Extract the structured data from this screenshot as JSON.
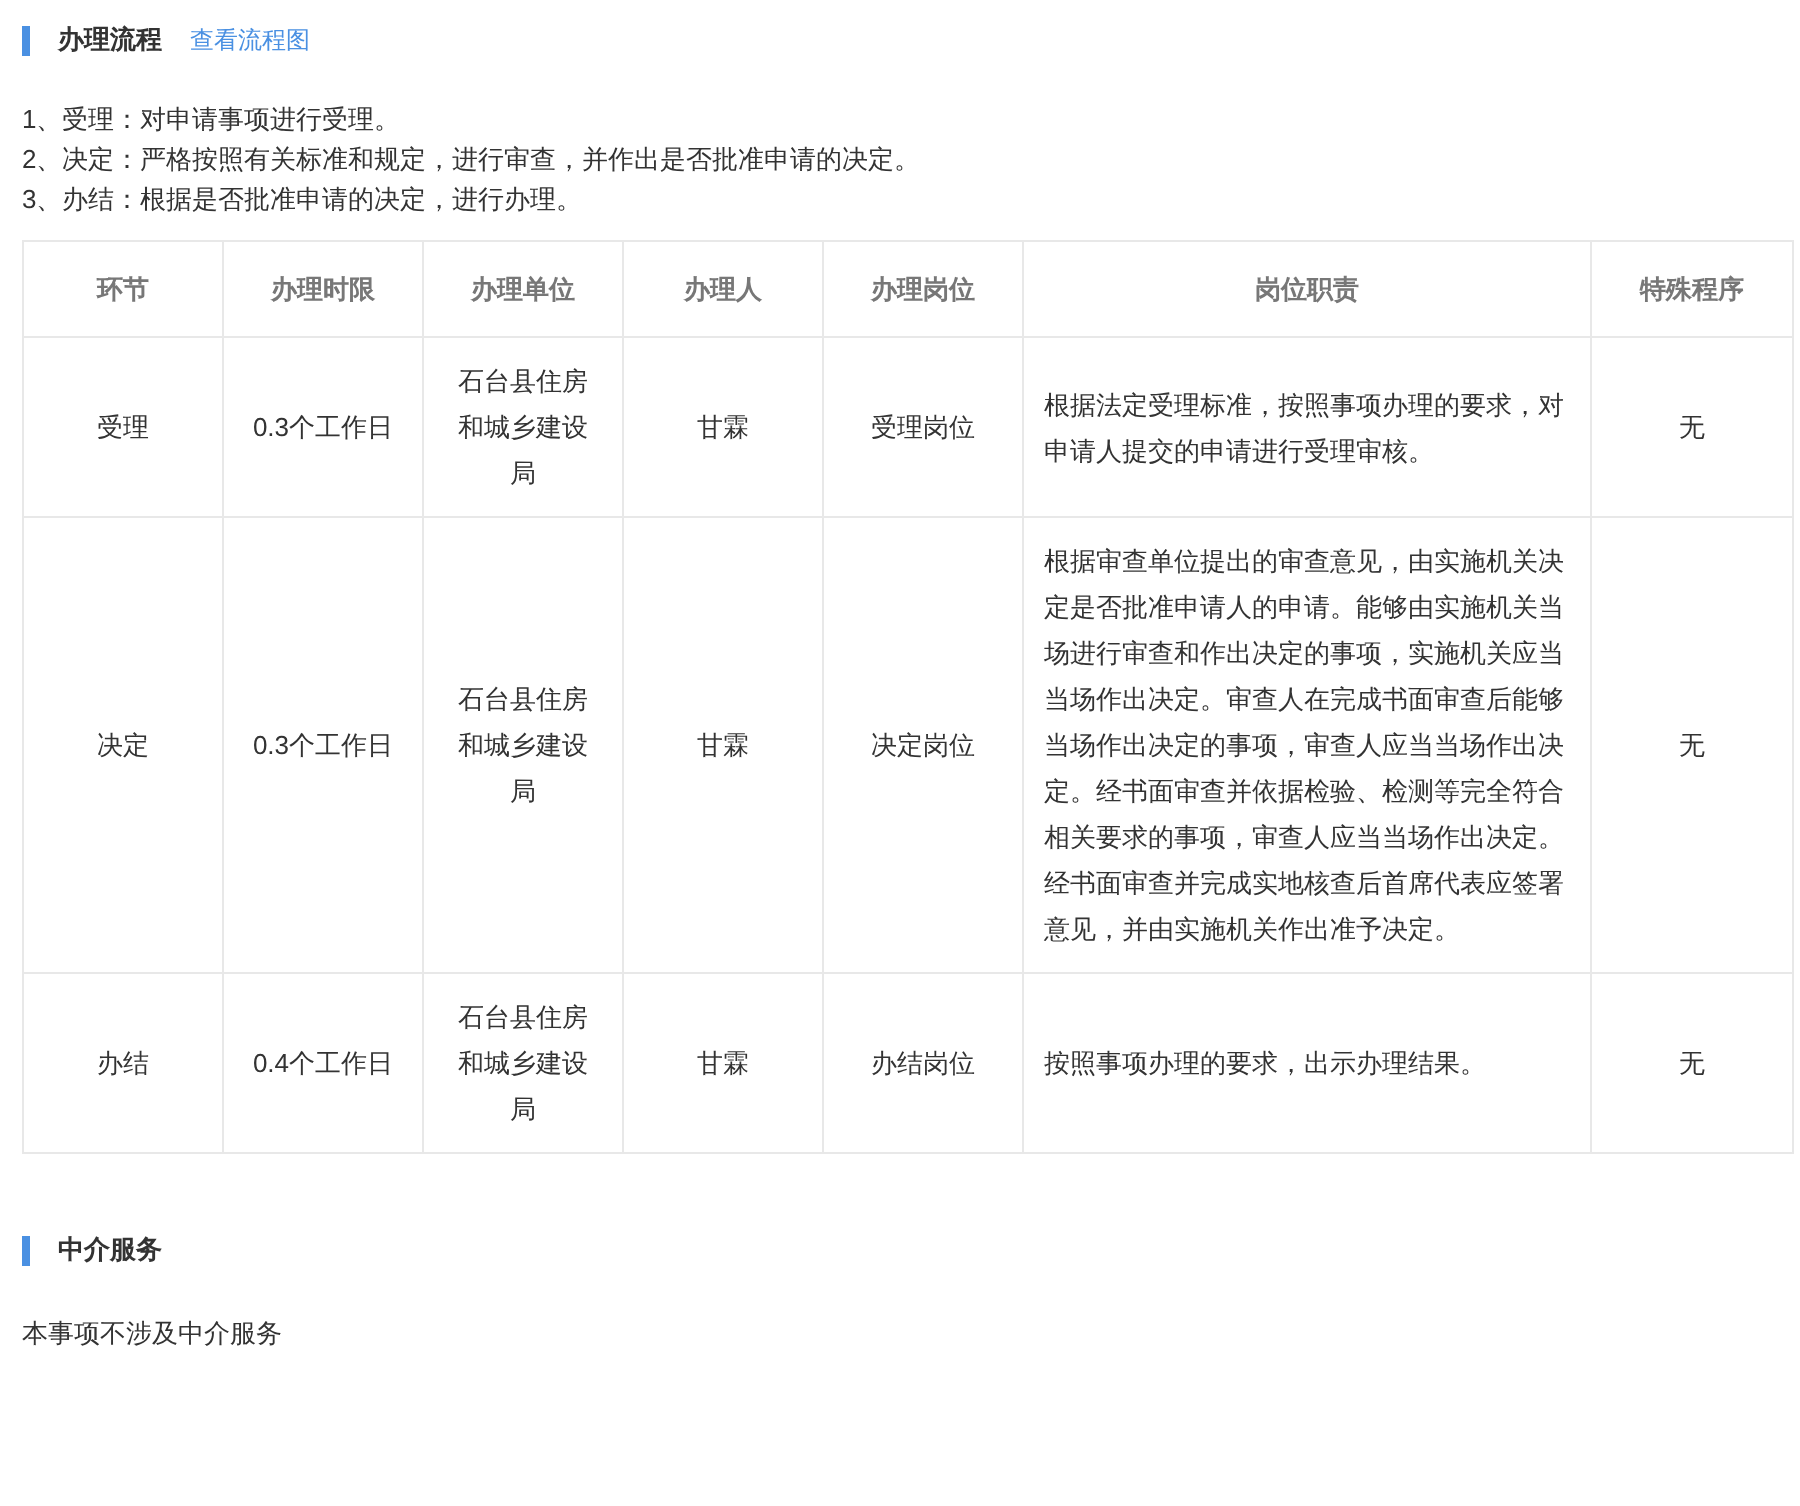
{
  "process": {
    "title": "办理流程",
    "link": "查看流程图",
    "steps": [
      "1、受理：对申请事项进行受理。",
      "2、决定：严格按照有关标准和规定，进行审查，并作出是否批准申请的决定。",
      "3、办结：根据是否批准申请的决定，进行办理。"
    ],
    "table": {
      "columns": [
        "环节",
        "办理时限",
        "办理单位",
        "办理人",
        "办理岗位",
        "岗位职责",
        "特殊程序"
      ],
      "rows": [
        [
          "受理",
          "0.3个工作日",
          "石台县住房和城乡建设局",
          "甘霖",
          "受理岗位",
          "根据法定受理标准，按照事项办理的要求，对申请人提交的申请进行受理审核。",
          "无"
        ],
        [
          "决定",
          "0.3个工作日",
          "石台县住房和城乡建设局",
          "甘霖",
          "决定岗位",
          "根据审查单位提出的审查意见，由实施机关决定是否批准申请人的申请。能够由实施机关当场进行审查和作出决定的事项，实施机关应当当场作出决定。审查人在完成书面审查后能够当场作出决定的事项，审查人应当当场作出决定。经书面审查并依据检验、检测等完全符合相关要求的事项，审查人应当当场作出决定。经书面审查并完成实地核查后首席代表应签署意见，并由实施机关作出准予决定。",
          "无"
        ],
        [
          "办结",
          "0.4个工作日",
          "石台县住房和城乡建设局",
          "甘霖",
          "办结岗位",
          "按照事项办理的要求，出示办理结果。",
          "无"
        ]
      ]
    }
  },
  "intermediary": {
    "title": "中介服务",
    "text": "本事项不涉及中介服务"
  }
}
